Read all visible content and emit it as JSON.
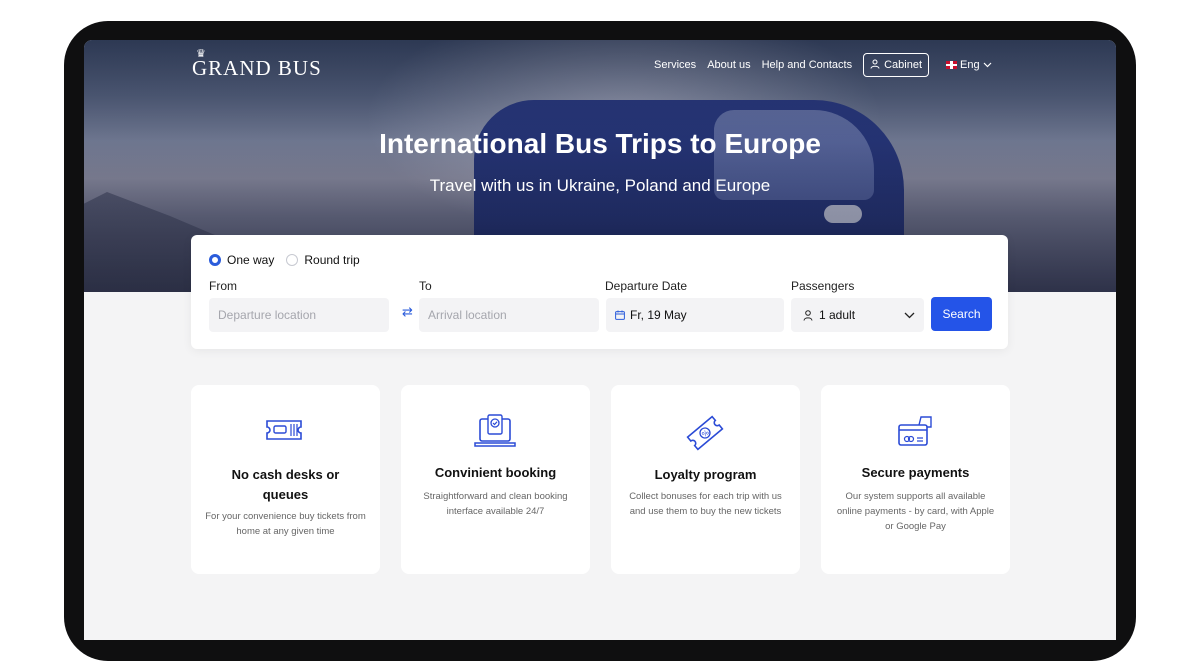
{
  "brand": {
    "name": "Grand Bus",
    "logo_text": "GRAND BUS"
  },
  "nav": {
    "links": [
      "Services",
      "About us",
      "Help and Contacts"
    ],
    "cabinet_label": "Cabinet",
    "language": "Eng"
  },
  "hero": {
    "title": "International Bus Trips to Europe",
    "subtitle": "Travel with us in Ukraine, Poland and Europe"
  },
  "search": {
    "trip_types": [
      {
        "label": "One way",
        "selected": true
      },
      {
        "label": "Round trip",
        "selected": false
      }
    ],
    "from_label": "From",
    "from_placeholder": "Departure location",
    "to_label": "To",
    "to_placeholder": "Arrival location",
    "date_label": "Departure Date",
    "date_value": "Fr, 19 May",
    "passengers_label": "Passengers",
    "passengers_value": "1 adult",
    "search_button": "Search"
  },
  "features": [
    {
      "icon": "ticket-icon",
      "title": "No cash desks or queues",
      "description": "For your convenience buy tickets from home at any given time"
    },
    {
      "icon": "laptop-check-icon",
      "title": "Convinient booking",
      "description": "Straightforward and clean booking interface available 24/7"
    },
    {
      "icon": "discount-ticket-icon",
      "title": "Loyalty program",
      "description": "Collect bonuses for each trip with us and use them to buy the new tickets"
    },
    {
      "icon": "card-payment-icon",
      "title": "Secure payments",
      "description": "Our system supports all available online payments - by card, with Apple or Google Pay"
    }
  ],
  "colors": {
    "accent": "#2454e8",
    "page_bg": "#f4f4f5",
    "device": "#0f0f10"
  }
}
